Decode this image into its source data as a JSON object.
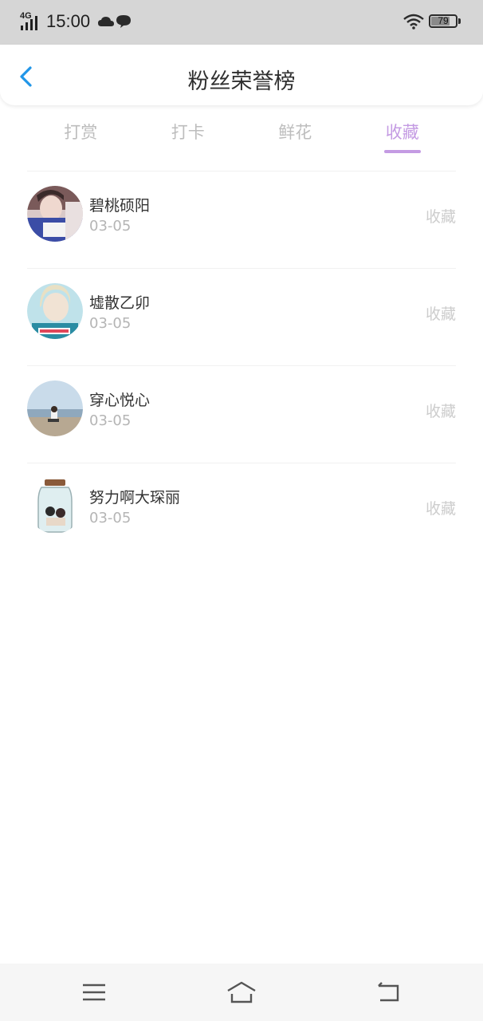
{
  "status_bar": {
    "network": "4G",
    "time": "15:00",
    "battery": "79",
    "battery_level": 0.79,
    "icons": [
      "signal-icon",
      "cloud-icon",
      "message-icon",
      "wifi-icon",
      "battery-icon"
    ]
  },
  "header": {
    "title": "粉丝荣誉榜",
    "back_icon": "chevron-left-icon",
    "accent_color": "#2196e8"
  },
  "tabs": [
    {
      "label": "打赏",
      "active": false
    },
    {
      "label": "打卡",
      "active": false
    },
    {
      "label": "鲜花",
      "active": false
    },
    {
      "label": "收藏",
      "active": true
    }
  ],
  "active_tab_color": "#c49be3",
  "list": [
    {
      "name": "碧桃硕阳",
      "date": "03-05",
      "type": "收藏"
    },
    {
      "name": "墟散乙卯",
      "date": "03-05",
      "type": "收藏"
    },
    {
      "name": "穿心悦心",
      "date": "03-05",
      "type": "收藏"
    },
    {
      "name": "努力啊大琛丽",
      "date": "03-05",
      "type": "收藏"
    }
  ],
  "nav": {
    "icons": [
      "menu-icon",
      "home-icon",
      "back-icon"
    ]
  }
}
